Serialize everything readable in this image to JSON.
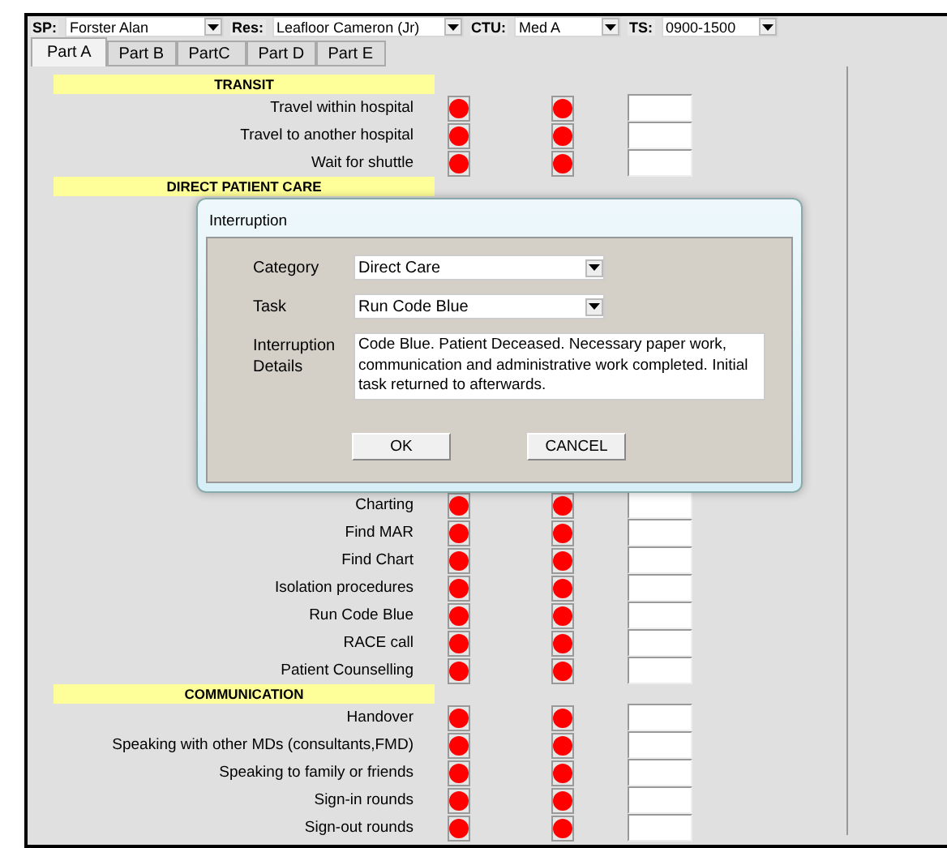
{
  "top_bar": [
    {
      "label": "SP:",
      "value": "Forster Alan"
    },
    {
      "label": "Res:",
      "value": "Leafloor Cameron (Jr)"
    },
    {
      "label": "CTU:",
      "value": "Med A"
    },
    {
      "label": "TS:",
      "value": "0900-1500"
    }
  ],
  "tabs": [
    {
      "label": "Part A",
      "selected": true
    },
    {
      "label": "Part B",
      "selected": false
    },
    {
      "label": "PartC",
      "selected": false
    },
    {
      "label": "Part D",
      "selected": false
    },
    {
      "label": "Part E",
      "selected": false
    }
  ],
  "sections": [
    {
      "title": "TRANSIT",
      "rows": [
        "Travel within hospital",
        "Travel to another hospital",
        "Wait for shuttle"
      ]
    },
    {
      "title": "DIRECT PATIENT CARE",
      "rows": [
        "Charting",
        "Find MAR",
        "Find Chart",
        "Isolation procedures",
        "Run Code Blue",
        "RACE call",
        "Patient Counselling"
      ]
    },
    {
      "title": "COMMUNICATION",
      "rows": [
        "Handover",
        "Speaking with other MDs (consultants,FMD)",
        "Speaking to family or friends",
        "Sign-in rounds",
        "Sign-out rounds"
      ]
    }
  ],
  "dialog": {
    "title": "Interruption",
    "category": {
      "label": "Category",
      "value": "Direct Care"
    },
    "task": {
      "label": "Task",
      "value": "Run Code Blue"
    },
    "details": {
      "label": "Interruption Details",
      "value": "Code Blue. Patient Deceased. Necessary paper work, communication and administrative work completed. Initial task returned to afterwards."
    },
    "buttons": [
      "OK",
      "CANCEL"
    ]
  }
}
